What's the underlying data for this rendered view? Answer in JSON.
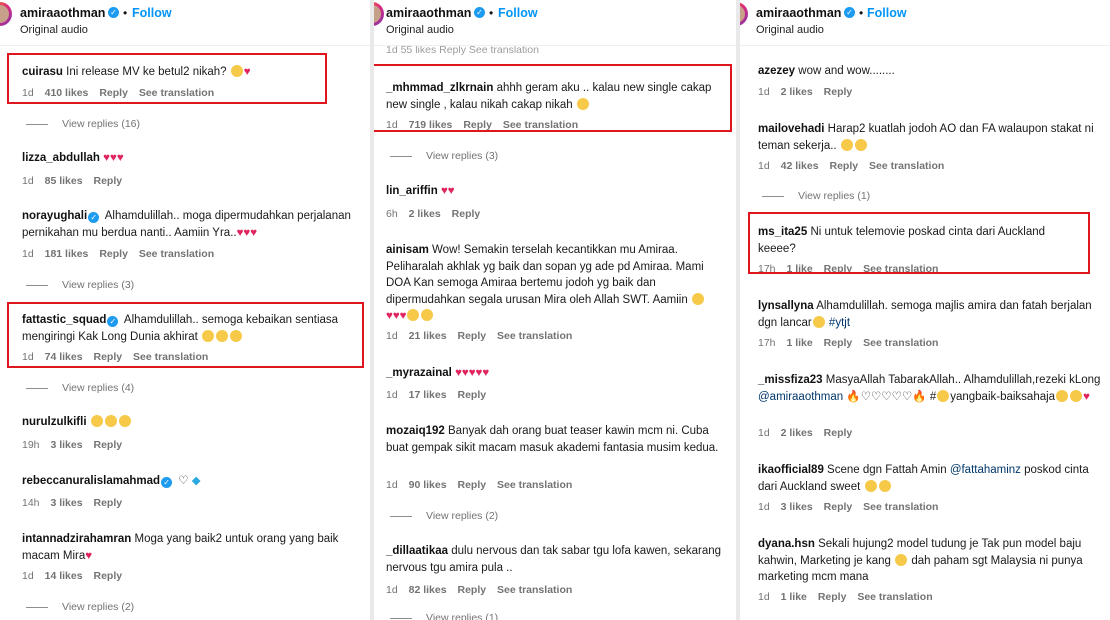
{
  "header": {
    "username": "amiraaothman",
    "follow": "Follow",
    "audio": "Original audio"
  },
  "panels": [
    {
      "comments": [
        {
          "user": "cuirasu",
          "text": "Ini release MV ke betul2 nikah? 😭❤️",
          "time": "1d",
          "likes": "410 likes",
          "reply": "Reply",
          "translate": "See translation",
          "view_replies": "View replies (16)"
        },
        {
          "user": "lizza_abdullah",
          "text": "❤️❤️❤️",
          "time": "1d",
          "likes": "85 likes",
          "reply": "Reply"
        },
        {
          "user": "norayughali",
          "text": "Alhamdulillah.. moga dipermudahkan perjalanan pernikahan mu berdua nanti.. Aamiin Yra..❤️❤️❤️",
          "time": "1d",
          "likes": "181 likes",
          "reply": "Reply",
          "translate": "See translation",
          "view_replies": "View replies (3)"
        },
        {
          "user": "fattastic_squad",
          "text": "Alhamdulillah.. semoga kebaikan sentiasa mengiringi Kak Long Dunia akhirat 🤲🥰🥹",
          "time": "1d",
          "likes": "74 likes",
          "reply": "Reply",
          "translate": "See translation",
          "view_replies": "View replies (4)"
        },
        {
          "user": "nurulzulkifli",
          "text": "🤩🤩🤩",
          "time": "19h",
          "likes": "3 likes",
          "reply": "Reply"
        },
        {
          "user": "rebeccanuralislamahmad",
          "text": "🤍💎",
          "time": "14h",
          "likes": "3 likes",
          "reply": "Reply"
        },
        {
          "user": "intannadzirahamran",
          "text": "Moga yang baik2 untuk orang yang baik macam Mira❤️",
          "time": "1d",
          "likes": "14 likes",
          "reply": "Reply",
          "view_replies": "View replies (2)"
        }
      ]
    },
    {
      "comments": [
        {
          "top_partial": "1d   55 likes   Reply   See translation"
        },
        {
          "user": "_mhmmad_zlkrnain",
          "text": "ahhh geram aku .. kalau new single cakap new single , kalau nikah cakap nikah 😂",
          "time": "1d",
          "likes": "719 likes",
          "reply": "Reply",
          "translate": "See translation",
          "view_replies": "View replies (3)"
        },
        {
          "user": "lin_ariffin",
          "text": "❤️❤️",
          "time": "6h",
          "likes": "2 likes",
          "reply": "Reply"
        },
        {
          "user": "ainisam",
          "text": "Wow! Semakin terselah kecantikkan mu Amiraa. Peliharalah akhlak yg baik dan sopan yg ade pd Amiraa. Mami DOA Kan semoga Amiraa bertemu jodoh yg baik dan dipermudahkan segala urusan Mira oleh Allah SWT. Aamiin 🙌❤️❤️❤️😘😘",
          "time": "1d",
          "likes": "21 likes",
          "reply": "Reply",
          "translate": "See translation"
        },
        {
          "user": "_myrazainal",
          "text": "❤️❤️❤️❤️❤️",
          "time": "1d",
          "likes": "17 likes",
          "reply": "Reply"
        },
        {
          "user": "mozaiq192",
          "text": "Banyak dah orang buat teaser kawin mcm ni. Cuba buat gempak sikit macam masuk akademi fantasia musim kedua.",
          "time": "1d",
          "likes": "90 likes",
          "reply": "Reply",
          "translate": "See translation",
          "view_replies": "View replies (2)"
        },
        {
          "user": "_dillaatikaa",
          "text": "dulu nervous dan tak sabar tgu lofa kawen, sekarang nervous tgu amira pula ..",
          "time": "1d",
          "likes": "82 likes",
          "reply": "Reply",
          "translate": "See translation",
          "view_replies": "View replies (1)"
        }
      ]
    },
    {
      "comments": [
        {
          "user": "azezey",
          "text": "wow and wow........",
          "time": "1d",
          "likes": "2 likes",
          "reply": "Reply"
        },
        {
          "user": "mailovehadi",
          "text": "Harap2 kuatlah jodoh AO dan FA walaupon stakat ni teman sekerja.. 🤩🥰",
          "time": "1d",
          "likes": "42 likes",
          "reply": "Reply",
          "translate": "See translation",
          "view_replies": "View replies (1)"
        },
        {
          "user": "ms_ita25",
          "text": "Ni untuk telemovie poskad cinta dari Auckland keeee?",
          "time": "17h",
          "likes": "1 like",
          "reply": "Reply",
          "translate": "See translation"
        },
        {
          "user": "lynsallyna",
          "text": "Alhamdulillah. semoga majlis amira dan fatah berjalan dgn lancar🥰",
          "hashtag": "#ytjt",
          "time": "17h",
          "likes": "1 like",
          "reply": "Reply",
          "translate": "See translation"
        },
        {
          "user": "_missfiza23",
          "text": "MasyaAllah TabarakAllah.. Alhamdulillah,rezeki kLong",
          "mention": "@amiraaothman",
          "text2": "🔥🤍🤍🤍🤍🤍🔥 #🙌yangbaik-baiksahaja👌🥰❤️",
          "time": "1d",
          "likes": "2 likes",
          "reply": "Reply"
        },
        {
          "user": "ikaofficial89",
          "text": "Scene dgn Fattah Amin",
          "mention": "@fattahaminz",
          "text2": "poskod cinta dari Auckland sweet 😂🤩",
          "time": "1d",
          "likes": "3 likes",
          "reply": "Reply",
          "translate": "See translation"
        },
        {
          "user": "dyana.hsn",
          "text": "Sekali hujung2 model tudung je Tak pun model baju kahwin, Marketing je kang 😂 dah paham sgt Malaysia ni punya marketing mcm mana",
          "time": "1d",
          "likes": "1 like",
          "reply": "Reply",
          "translate": "See translation"
        }
      ]
    }
  ]
}
